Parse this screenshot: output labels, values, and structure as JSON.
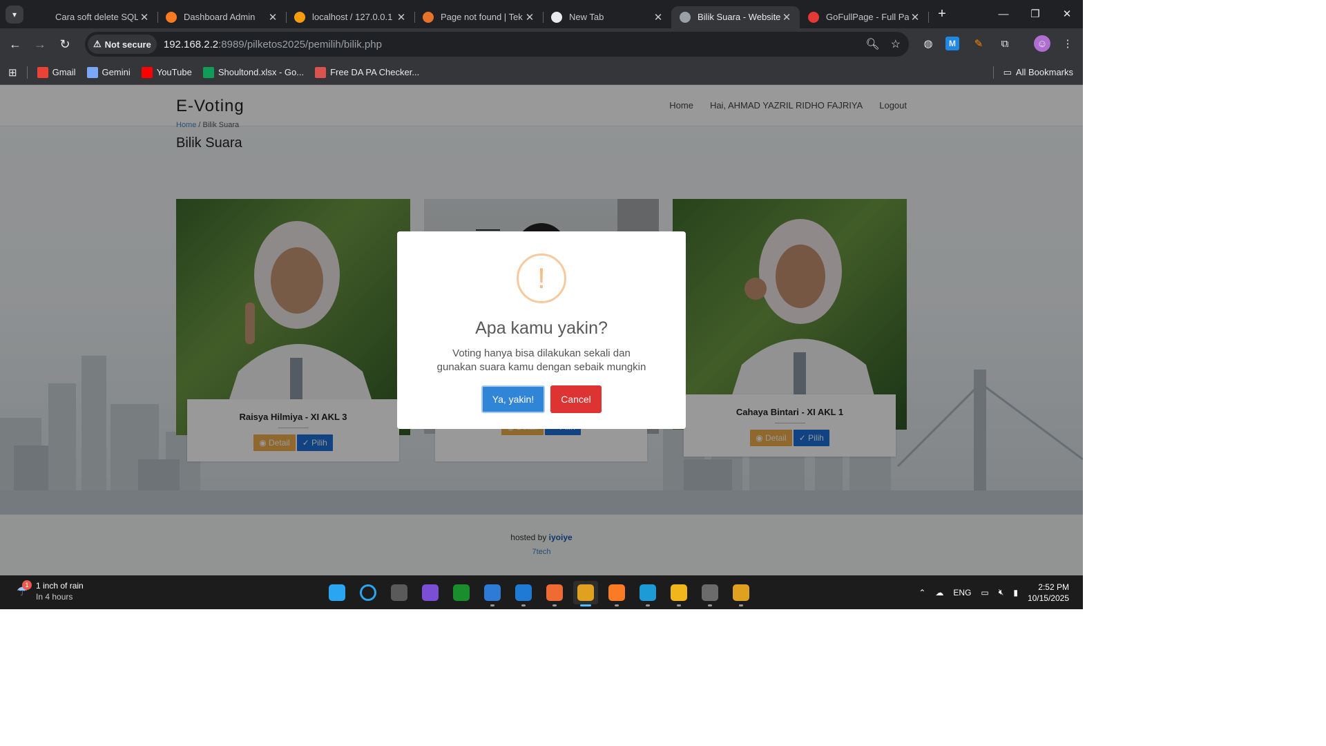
{
  "browser": {
    "tabs": [
      {
        "title": "Cara soft delete SQL",
        "icon": "openai-icon",
        "color": "#202124",
        "active": false
      },
      {
        "title": "Dashboard Admin",
        "icon": "xampp-icon",
        "color": "#fb7a24",
        "active": false
      },
      {
        "title": "localhost / 127.0.0.1 /",
        "icon": "phpmyadmin-icon",
        "color": "#f89c0e",
        "active": false
      },
      {
        "title": "Page not found | Tek",
        "icon": "site-icon",
        "color": "#e8722a",
        "active": false
      },
      {
        "title": "New Tab",
        "icon": "chrome-icon",
        "color": "#e8eaed",
        "active": false
      },
      {
        "title": "Bilik Suara - Website",
        "icon": "site-icon",
        "color": "#9aa0a6",
        "active": true
      },
      {
        "title": "GoFullPage - Full Pag",
        "icon": "gofullpage-icon",
        "color": "#e53935",
        "active": false
      }
    ],
    "security_chip": "Not secure",
    "url_host": "192.168.2.2",
    "url_rest": ":8989/pilketos2025/pemilih/bilik.php",
    "bookmarks": [
      {
        "label": "Gmail",
        "icon": "gmail-icon",
        "color": "#ea4335"
      },
      {
        "label": "Gemini",
        "icon": "gemini-icon",
        "color": "#7aa7f7"
      },
      {
        "label": "YouTube",
        "icon": "youtube-icon",
        "color": "#ff0000"
      },
      {
        "label": "Shoultond.xlsx - Go...",
        "icon": "sheets-icon",
        "color": "#0f9d58"
      },
      {
        "label": "Free DA PA Checker...",
        "icon": "site-icon",
        "color": "#d9534f"
      }
    ],
    "all_bookmarks": "All Bookmarks"
  },
  "site": {
    "brand": "E-Voting",
    "nav": [
      "Home",
      "Hai, AHMAD YAZRIL RIDHO FAJRIYA",
      "Logout"
    ],
    "breadcrumb_home": "Home",
    "breadcrumb_sep": "/",
    "breadcrumb_current": "Bilik Suara",
    "title": "Bilik Suara",
    "candidates": [
      {
        "name": "Raisya Hilmiya - XI AKL 3",
        "detail": "Detail",
        "pilih": "Pilih"
      },
      {
        "name": "",
        "detail": "Detail",
        "pilih": "Pilih"
      },
      {
        "name": "Cahaya Bintari - XI AKL 1",
        "detail": "Detail",
        "pilih": "Pilih"
      }
    ],
    "footer_hosted": "hosted by",
    "footer_host_name": "iyoiye",
    "footer_tech": "7tech"
  },
  "dialog": {
    "icon": "!",
    "title": "Apa kamu yakin?",
    "text": "Voting hanya bisa dilakukan sekali dan gunakan suara kamu dengan sebaik mungkin",
    "confirm": "Ya, yakin!",
    "cancel": "Cancel"
  },
  "taskbar": {
    "weather_title": "1 inch of rain",
    "weather_sub": "In 4 hours",
    "weather_badge": "1",
    "apps": [
      "start-icon",
      "search-icon",
      "task-view-icon",
      "app-icon",
      "xbox-icon",
      "photos-icon",
      "vscode-icon",
      "postman-icon",
      "chrome-icon",
      "xampp-icon",
      "edge-icon",
      "file-explorer-icon",
      "settings-icon",
      "chrome-profile-icon"
    ],
    "lang": "ENG",
    "time": "2:52 PM",
    "date": "10/15/2025"
  }
}
